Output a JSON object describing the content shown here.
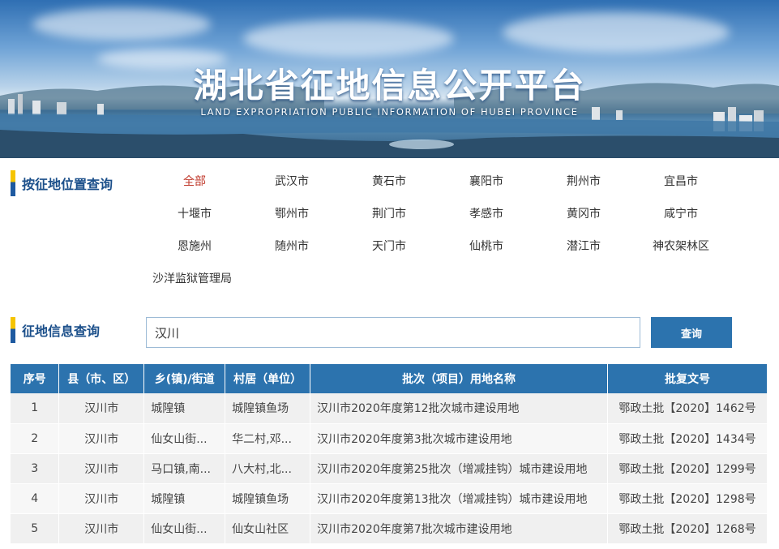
{
  "banner": {
    "title": "湖北省征地信息公开平台",
    "subtitle": "LAND EXPROPRIATION PUBLIC INFORMATION OF HUBEI PROVINCE"
  },
  "location_filter": {
    "label": "按征地位置查询",
    "items": [
      "全部",
      "武汉市",
      "黄石市",
      "襄阳市",
      "荆州市",
      "宜昌市",
      "十堰市",
      "鄂州市",
      "荆门市",
      "孝感市",
      "黄冈市",
      "咸宁市",
      "恩施州",
      "随州市",
      "天门市",
      "仙桃市",
      "潜江市",
      "神农架林区",
      "沙洋监狱管理局"
    ],
    "active": "全部",
    "colors": {
      "active": "#c0392b",
      "label": "#1b4f8a"
    }
  },
  "search": {
    "label": "征地信息查询",
    "value": "汉川",
    "button_label": "查询"
  },
  "table": {
    "headers": [
      "序号",
      "县（市、区）",
      "乡(镇)/街道",
      "村居（单位）",
      "批次（项目）用地名称",
      "批复文号"
    ],
    "rows": [
      [
        "1",
        "汉川市",
        "城隍镇",
        "城隍镇鱼场",
        "汉川市2020年度第12批次城市建设用地",
        "鄂政土批【2020】1462号"
      ],
      [
        "2",
        "汉川市",
        "仙女山街...",
        "华二村,邓...",
        "汉川市2020年度第3批次城市建设用地",
        "鄂政土批【2020】1434号"
      ],
      [
        "3",
        "汉川市",
        "马口镇,南...",
        "八大村,北...",
        "汉川市2020年度第25批次（增减挂钩）城市建设用地",
        "鄂政土批【2020】1299号"
      ],
      [
        "4",
        "汉川市",
        "城隍镇",
        "城隍镇鱼场",
        "汉川市2020年度第13批次（增减挂钩）城市建设用地",
        "鄂政土批【2020】1298号"
      ],
      [
        "5",
        "汉川市",
        "仙女山街...",
        "仙女山社区",
        "汉川市2020年度第7批次城市建设用地",
        "鄂政土批【2020】1268号"
      ]
    ],
    "header_color": "#2c73ae"
  }
}
